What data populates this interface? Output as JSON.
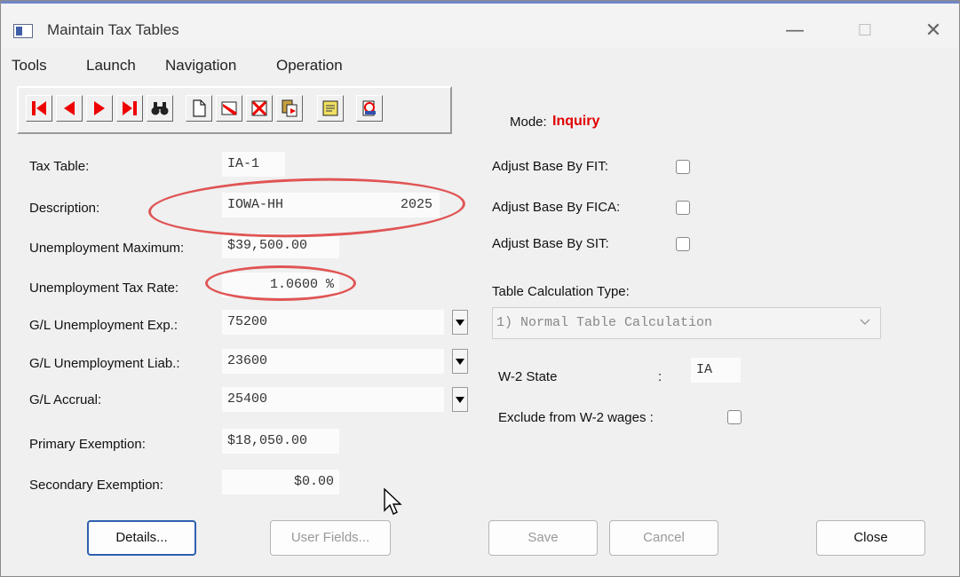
{
  "window": {
    "title": "Maintain Tax Tables",
    "minimize": "—",
    "maximize": "☐",
    "close": "✕"
  },
  "menu": [
    "Tools",
    "Launch",
    "Navigation",
    "Operation"
  ],
  "mode": {
    "label": "Mode:",
    "value": "Inquiry"
  },
  "fields": {
    "tax_table": {
      "label": "Tax Table:",
      "value": "IA-1"
    },
    "description": {
      "label": "Description:",
      "name": "IOWA-HH",
      "year": "2025"
    },
    "unemp_max": {
      "label": "Unemployment Maximum:",
      "value": "$39,500.00"
    },
    "unemp_rate": {
      "label": "Unemployment Tax Rate:",
      "value": "1.0600 %"
    },
    "gl_exp": {
      "label": "G/L Unemployment Exp.:",
      "value": "75200"
    },
    "gl_liab": {
      "label": "G/L Unemployment Liab.:",
      "value": "23600"
    },
    "gl_accrual": {
      "label": "G/L Accrual:",
      "value": "25400"
    },
    "primary_exemption": {
      "label": "Primary Exemption:",
      "value": "$18,050.00"
    },
    "secondary_exemption": {
      "label": "Secondary Exemption:",
      "value": "$0.00"
    }
  },
  "right": {
    "adjust_fit": "Adjust Base By FIT:",
    "adjust_fica": "Adjust Base By FICA:",
    "adjust_sit": "Adjust Base By SIT:",
    "calc_type_label": "Table Calculation Type:",
    "calc_type_value": "1) Normal Table Calculation",
    "w2_state_label": "W-2 State",
    "w2_state_colon": ":",
    "w2_state_value": "IA",
    "exclude_w2": "Exclude from W-2 wages :"
  },
  "buttons": {
    "details": "Details...",
    "user_fields": "User Fields...",
    "save": "Save",
    "cancel": "Cancel",
    "close": "Close"
  },
  "colors": {
    "mode_value": "#e00000",
    "annotation": "#e05555",
    "primary_border": "#2f5fb0"
  },
  "toolbar_icons": [
    "first-record-icon",
    "previous-record-icon",
    "next-record-icon",
    "last-record-icon",
    "find-icon",
    "new-icon",
    "edit-icon",
    "delete-icon",
    "copy-icon",
    "notes-icon",
    "report-icon"
  ]
}
